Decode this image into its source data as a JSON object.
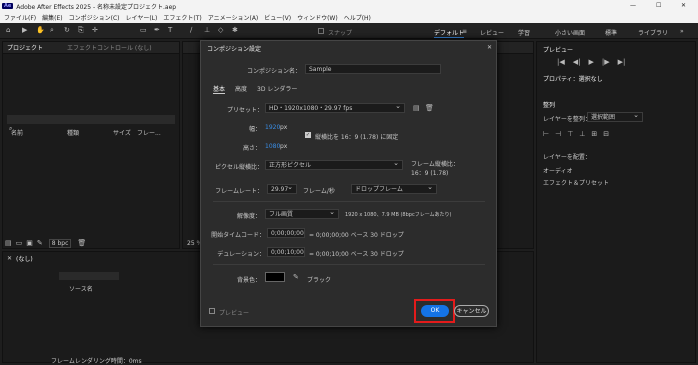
{
  "window": {
    "title": "Adobe After Effects 2025 - 名称未設定プロジェクト.aep",
    "app_badge": "Ae",
    "minimize": "—",
    "maximize": "☐",
    "close": "✕"
  },
  "menu": [
    "ファイル(F)",
    "編集(E)",
    "コンポジション(C)",
    "レイヤー(L)",
    "エフェクト(T)",
    "アニメーション(A)",
    "ビュー(V)",
    "ウィンドウ(W)",
    "ヘルプ(H)"
  ],
  "toolbar": {
    "snap_label": "スナップ",
    "workspaces": [
      "デフォルト",
      "≡",
      "レビュー",
      "学習",
      "小さい画面",
      "標準",
      "ライブラリ"
    ],
    "more": "»"
  },
  "project_panel": {
    "tab_project": "プロジェクト",
    "tab_effects": "エフェクトコントロール (なし)",
    "columns": [
      "名前",
      "種類",
      "サイズ",
      "フレー..."
    ],
    "bpc": "8 bpc"
  },
  "timeline": {
    "tab": "(なし)",
    "layer_col": "ソース名",
    "footer": "フレームレンダリング時間：0ms",
    "zoom_pct": "25 %"
  },
  "right_panel": {
    "preview_title": "プレビュー",
    "properties_title": "プロパティ：選択なし",
    "align_title": "整列",
    "align_to_label": "レイヤーを整列：",
    "align_to_value": "選択範囲",
    "distribute_label": "レイヤーを配置：",
    "audio_label": "オーディオ",
    "effects_label": "エフェクト＆プリセット"
  },
  "dialog": {
    "title": "コンポジション設定",
    "name_label": "コンポジション名：",
    "name_value": "Sample",
    "tabs": [
      "基本",
      "高度",
      "3D レンダラー"
    ],
    "preset_label": "プリセット：",
    "preset_value": "HD・1920x1080・29.97 fps",
    "width_label": "幅：",
    "width_value": "1920",
    "px": "px",
    "height_label": "高さ：",
    "height_value": "1080",
    "lock_label": "縦横比を 16：9 (1.78) に固定",
    "pixel_aspect_label": "ピクセル縦横比：",
    "pixel_aspect_value": "正方形ピクセル",
    "frame_aspect_label": "フレーム縦横比：",
    "frame_aspect_value": "16：9 (1.78)",
    "framerate_label": "フレームレート：",
    "framerate_value": "29.97",
    "fps_unit": "フレーム/秒",
    "dropframe_value": "ドロップフレーム",
    "resolution_label": "解像度：",
    "resolution_value": "フル画質",
    "resolution_info": "1920 x 1080、7.9 MB (8bpcフレームあたり)",
    "start_tc_label": "開始タイムコード：",
    "start_tc_value": "0;00;00;00",
    "start_tc_info": "= 0;00;00;00 ベース 30  ドロップ",
    "duration_label": "デュレーション：",
    "duration_value": "0;00;10;00",
    "duration_info": "= 0;00;10;00 ベース 30  ドロップ",
    "bg_label": "背景色：",
    "bg_name": "ブラック",
    "preview_label": "プレビュー",
    "ok": "OK",
    "cancel": "キャンセル",
    "close": "✕",
    "colors": {
      "ok_bg": "#1473e6",
      "highlight": "#e31b1b",
      "link": "#3a8ee6"
    }
  }
}
